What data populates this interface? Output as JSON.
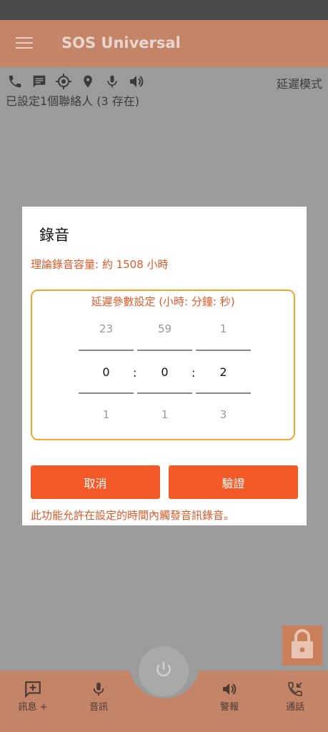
{
  "app": {
    "title": "SOS Universal"
  },
  "status_line": {
    "mode": "延遲模式",
    "contacts": "已設定1個聯絡人 (3 存在)"
  },
  "toolbar_icons": [
    "phone-icon",
    "message-icon",
    "gps-icon",
    "location-icon",
    "mic-icon",
    "speaker-icon"
  ],
  "dialog": {
    "title": "錄音",
    "capacity": "理論錄音容量: 約 1508 小時",
    "delay_title": "延遲參數設定 (小時: 分鐘: 秒)",
    "pickers": [
      {
        "prev": "23",
        "value": "0",
        "next": "1"
      },
      {
        "prev": "59",
        "value": "0",
        "next": "1"
      },
      {
        "prev": "1",
        "value": "2",
        "next": "3"
      }
    ],
    "separator": ":",
    "cancel_label": "取消",
    "verify_label": "驗證",
    "note": "此功能允許在設定的時間內觸發音訊錄音。"
  },
  "bottom_nav": {
    "message": "訊息 +",
    "audio": "音訊",
    "alarm": "警報",
    "call": "通話"
  },
  "colors": {
    "accent": "#f45a28",
    "box_border": "#f0a830",
    "app_bar": "#c48467"
  }
}
